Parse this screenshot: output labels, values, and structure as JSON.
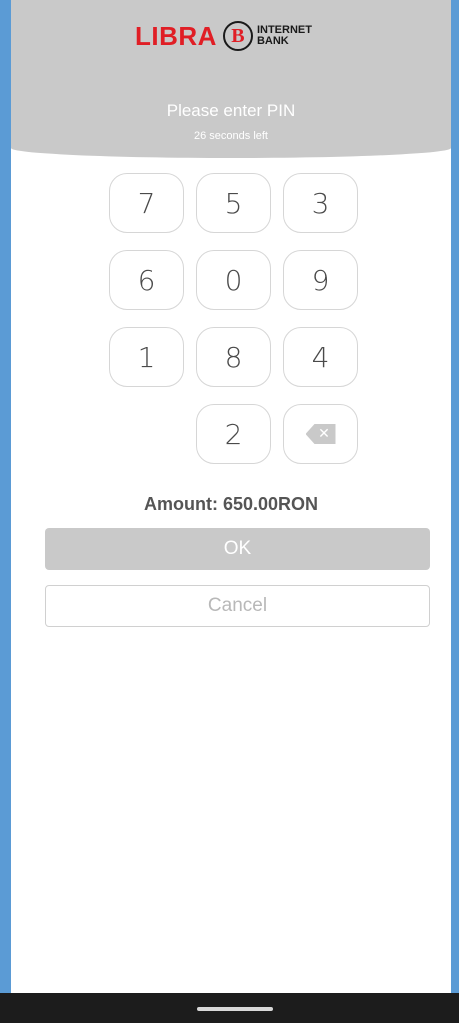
{
  "brand": {
    "name": "LIBRA",
    "emblem": "B",
    "sub_line1": "INTERNET",
    "sub_line2": "BANK",
    "color": "#e01e25"
  },
  "pin": {
    "prompt": "Please enter PIN",
    "countdown": "26 seconds left"
  },
  "keypad": {
    "keys": [
      "7",
      "5",
      "3",
      "6",
      "0",
      "9",
      "1",
      "8",
      "4",
      "2"
    ],
    "backspace_icon": "backspace-icon"
  },
  "amount": "Amount: 650.00RON",
  "buttons": {
    "ok": "OK",
    "cancel": "Cancel"
  },
  "colors": {
    "header_bg": "#c9c9c9",
    "frame": "#5b9bd5",
    "nav_bar": "#1c1c1c"
  }
}
